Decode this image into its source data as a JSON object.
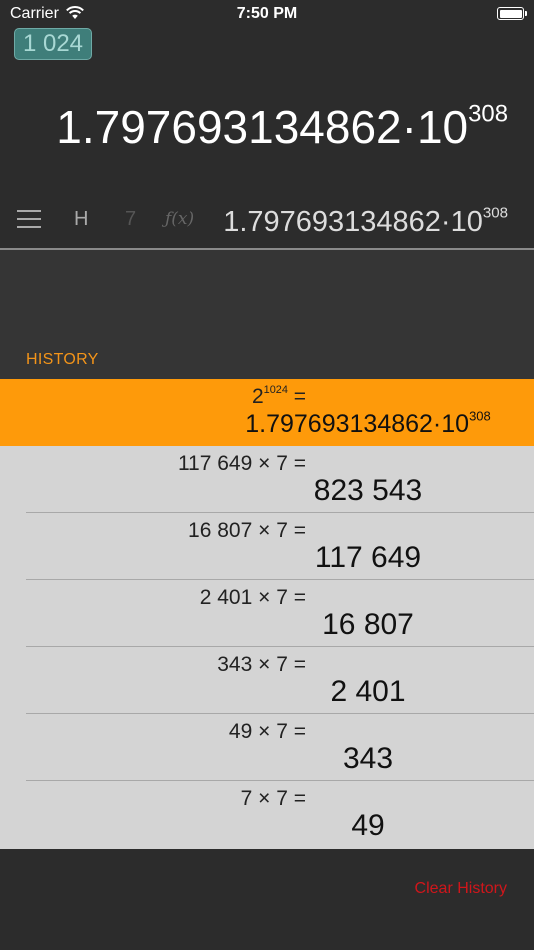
{
  "status": {
    "carrier": "Carrier",
    "time": "7:50 PM"
  },
  "memory_badge": "1 024",
  "display": {
    "mantissa": "1.797693134862·10",
    "exponent": "308"
  },
  "toolbar": {
    "history_label": "H",
    "digit_label": "7",
    "function_label": "ƒ(x)",
    "entry_mantissa": "1.797693134862·10",
    "entry_exponent": "308"
  },
  "history": {
    "title": "HISTORY",
    "clear_label": "Clear History",
    "items": [
      {
        "expr_base": "2",
        "expr_exp": "1024",
        "expr_rest": " =",
        "result_mantissa": "1.797693134862·10",
        "result_exponent": "308",
        "selected": true
      },
      {
        "expr": "117 649 × 7 =",
        "result": "823 543"
      },
      {
        "expr": "16 807 × 7 =",
        "result": "117 649"
      },
      {
        "expr": "2 401 × 7 =",
        "result": "16 807"
      },
      {
        "expr": "343 × 7 =",
        "result": "2 401"
      },
      {
        "expr": "49 × 7 =",
        "result": "343"
      },
      {
        "expr": "7 × 7 =",
        "result": "49"
      }
    ]
  },
  "colors": {
    "accent": "#fe9a0a",
    "memory": "#3f7e7a",
    "clear": "#d0161b"
  }
}
